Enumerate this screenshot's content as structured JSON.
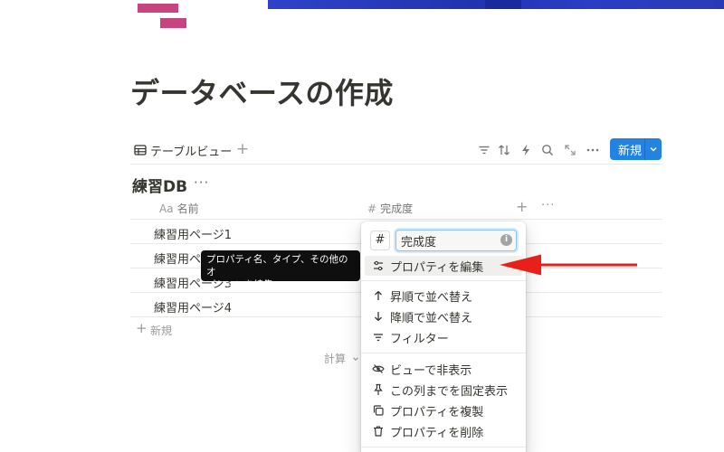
{
  "page": {
    "title": "データベースの作成",
    "colors": {
      "accent": "#2383e2",
      "icon_pink": "#c7457f",
      "cover_blue": "#2233b0",
      "arrow_red": "#e8201a"
    }
  },
  "view_bar": {
    "tab_label": "テーブルビュー",
    "new_label": "新規",
    "tools": [
      "filter-icon",
      "sort-icon",
      "lightning-icon",
      "search-icon",
      "expand-icon",
      "more-icon"
    ]
  },
  "database": {
    "title": "練習DB",
    "columns": [
      {
        "prefix": "Aa",
        "label": "名前"
      },
      {
        "prefix": "#",
        "label": "完成度"
      }
    ],
    "rows": [
      "練習用ページ1",
      "練習用ページ2",
      "練習用ページ3",
      "練習用ページ4"
    ],
    "add_label": "新規",
    "calc_label": "計算"
  },
  "tooltip": {
    "line1": "プロパティ名、タイプ、その他のオ",
    "line2": "プションを編集..."
  },
  "menu": {
    "type_symbol": "#",
    "name_value": "完成度",
    "items": [
      {
        "label": "プロパティを編集",
        "icon": "sliders-icon"
      },
      {
        "label": "昇順で並べ替え",
        "icon": "arrow-up-icon"
      },
      {
        "label": "降順で並べ替え",
        "icon": "arrow-down-icon"
      },
      {
        "label": "フィルター",
        "icon": "filter-icon"
      },
      {
        "label": "ビューで非表示",
        "icon": "eye-slash-icon"
      },
      {
        "label": "この列までを固定表示",
        "icon": "pin-icon"
      },
      {
        "label": "プロパティを複製",
        "icon": "duplicate-icon"
      },
      {
        "label": "プロパティを削除",
        "icon": "trash-icon"
      }
    ]
  }
}
